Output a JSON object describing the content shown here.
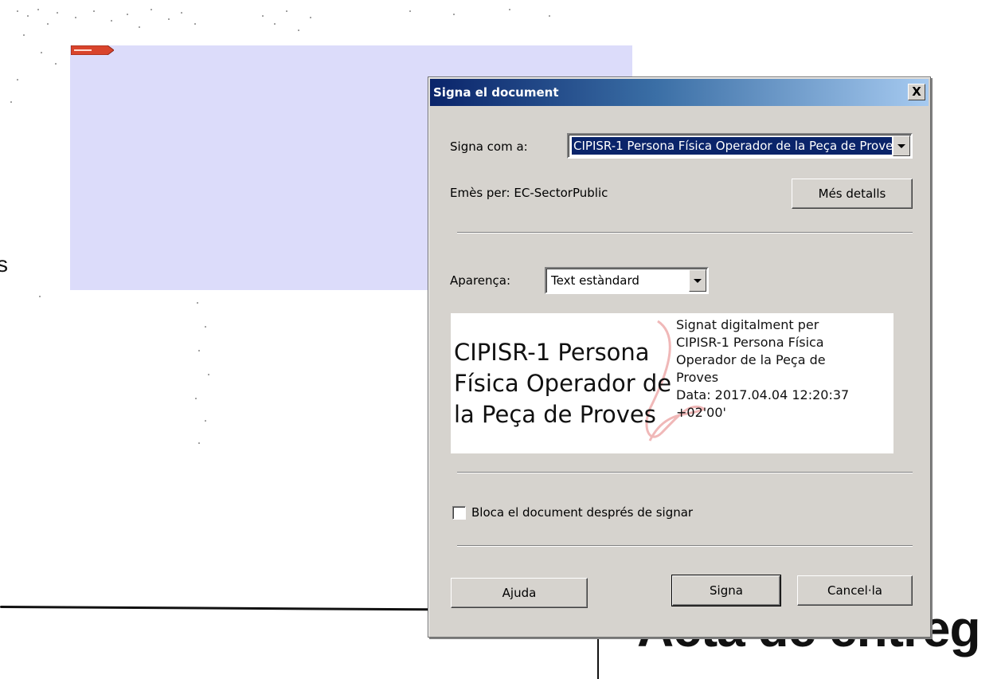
{
  "background": {
    "stray_letter": "s",
    "heading_fragment": "Acta de entreg"
  },
  "dialog": {
    "title": "Signa el document",
    "close_label": "X",
    "sign_as_label": "Signa com a:",
    "sign_as_value": "CIPISR-1 Persona Física Operador de la Peça de Proves",
    "issued_by": "Emès per: EC-SectorPublic",
    "more_details_button": "Més detalls",
    "appearance_label": "Aparença:",
    "appearance_value": "Text estàndard",
    "preview": {
      "name_lines": [
        "CIPISR-1 Persona",
        "Física Operador de",
        "la Peça de Proves"
      ],
      "detail_lines": [
        "Signat digitalment per",
        "CIPISR-1 Persona Física",
        "Operador de la Peça de",
        "Proves",
        "Data: 2017.04.04 12:20:37",
        "+02'00'"
      ]
    },
    "lock_checkbox_label": "Bloca el document després de signar",
    "lock_checked": false,
    "help_button": "Ajuda",
    "sign_button": "Signa",
    "cancel_button": "Cancel·la"
  },
  "colors": {
    "dialog_bg": "#d6d3ce",
    "title_start": "#0a246a",
    "title_end": "#a6caf0",
    "signature_field": "#dcdcfa",
    "selection": "#0a246a"
  }
}
